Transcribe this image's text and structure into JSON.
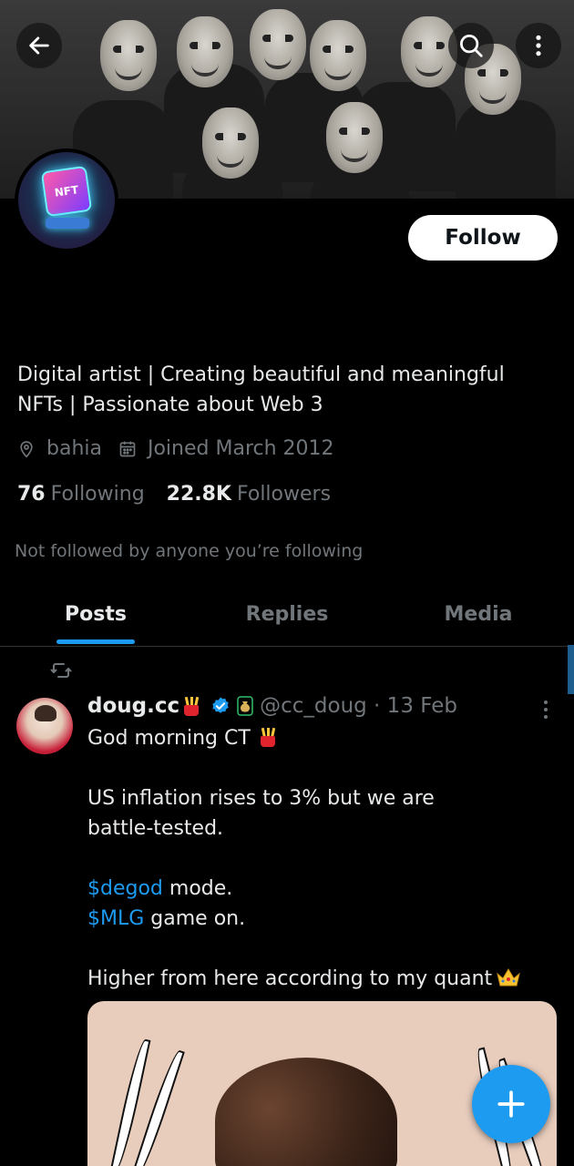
{
  "header": {
    "back_icon": "arrow-left-icon",
    "search_icon": "search-icon",
    "more_icon": "more-vertical-icon"
  },
  "profile": {
    "avatar_text": "NFT",
    "follow_label": "Follow",
    "bio_line1": "Digital artist | Creating beautiful and meaningful",
    "bio_line2": "NFTs | Passionate about Web 3",
    "location": "bahia",
    "joined": "Joined March 2012",
    "following_count": "76",
    "following_label": "Following",
    "followers_count": "22.8K",
    "followers_label": "Followers",
    "not_followed_text": "Not followed by anyone you’re following"
  },
  "tabs": [
    {
      "label": "Posts",
      "active": true
    },
    {
      "label": "Replies",
      "active": false
    },
    {
      "label": "Media",
      "active": false
    }
  ],
  "post": {
    "repost_icon": "repost-icon",
    "author_name": "doug.cc",
    "handle_and_date": "@cc_doug · 13 Feb",
    "line1": "God morning CT",
    "line2": "US inflation rises to 3% but we are",
    "line3": "battle-tested.",
    "tag1": "$degod",
    "line4_rest": " mode.",
    "tag2": "$MLG",
    "line5_rest": " game on.",
    "line6": "Higher from here according to my quant"
  },
  "fab": {
    "icon": "plus-icon"
  },
  "colors": {
    "accent": "#1d9bf0",
    "background": "#000000",
    "text": "#e7e9ea",
    "muted": "#71767b"
  }
}
